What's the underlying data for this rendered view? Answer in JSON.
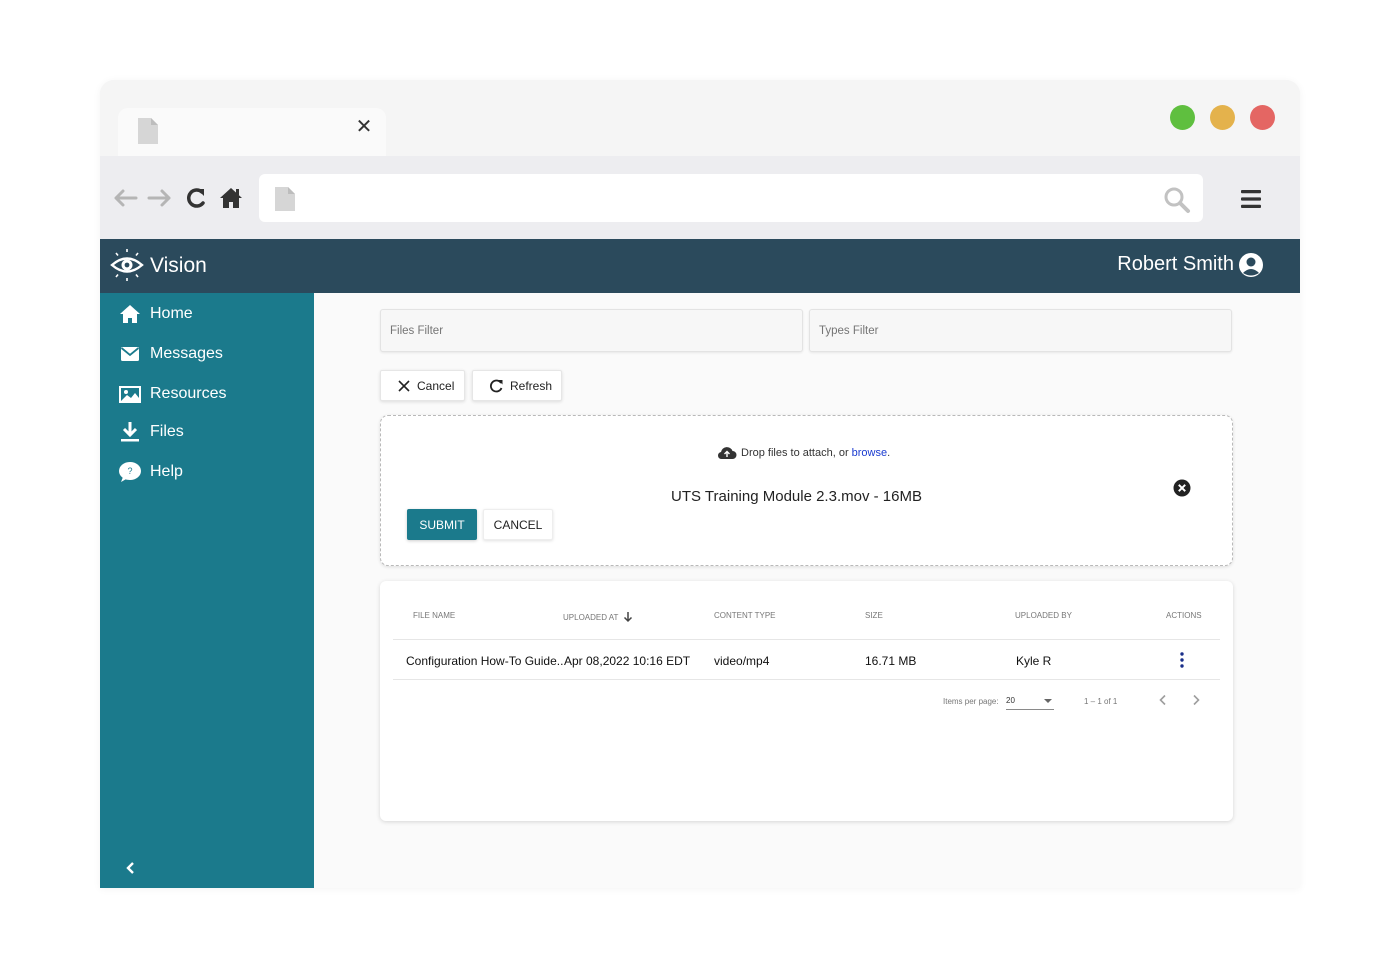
{
  "app": {
    "title": "Vision",
    "user_name": "Robert Smith"
  },
  "colors": {
    "appbar": "#2b4a5c",
    "sidebar": "#1b7a8c",
    "primary_button": "#1b7a8c",
    "link": "#1a3bd0",
    "traffic_green": "#5fbf3f",
    "traffic_yellow": "#e4b24c",
    "traffic_red": "#e46663"
  },
  "browser": {
    "tab_icon": "file-icon",
    "tab_close_icon": "close-icon",
    "nav_icons": [
      "back-arrow-icon",
      "forward-arrow-icon",
      "reload-icon",
      "home-icon"
    ],
    "url_icon": "file-icon",
    "search_icon": "search-icon",
    "menu_icon": "hamburger-icon"
  },
  "sidebar": {
    "items": [
      {
        "label": "Home",
        "icon": "home-icon"
      },
      {
        "label": "Messages",
        "icon": "envelope-icon"
      },
      {
        "label": "Resources",
        "icon": "image-icon"
      },
      {
        "label": "Files",
        "icon": "download-icon"
      },
      {
        "label": "Help",
        "icon": "help-bubble-icon"
      }
    ],
    "collapse_icon": "chevron-left-icon"
  },
  "filters": {
    "files_placeholder": "Files Filter",
    "types_placeholder": "Types Filter"
  },
  "actions": {
    "cancel_label": "Cancel",
    "refresh_label": "Refresh"
  },
  "upload": {
    "hint_text": "Drop files to attach, or",
    "browse_label": "browse",
    "hint_suffix": ".",
    "file_label": "UTS Training Module 2.3.mov - 16MB",
    "submit_label": "SUBMIT",
    "cancel_label": "CANCEL"
  },
  "table": {
    "columns": [
      "FILE NAME",
      "UPLOADED AT",
      "CONTENT TYPE",
      "SIZE",
      "UPLOADED BY",
      "ACTIONS"
    ],
    "sort_column": "UPLOADED AT",
    "sort_direction": "descending",
    "rows": [
      {
        "file_name": "Configuration How-To Guide..",
        "uploaded_at": "Apr 08,2022 10:16 EDT",
        "content_type": "video/mp4",
        "size": "16.71 MB",
        "uploaded_by": "Kyle R"
      }
    ]
  },
  "pagination": {
    "items_per_page_label": "Items per page:",
    "items_per_page": "20",
    "range_label": "1 – 1 of 1"
  }
}
